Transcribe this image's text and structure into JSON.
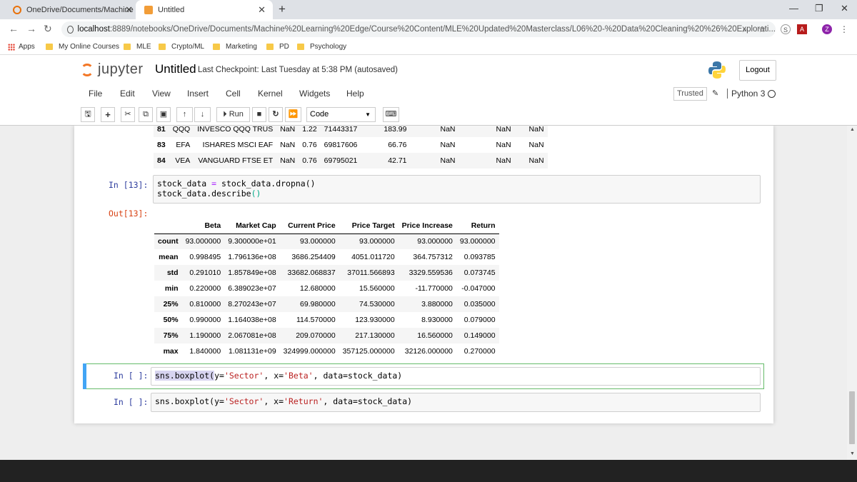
{
  "browser": {
    "tabs": [
      {
        "title": "OneDrive/Documents/Machine L"
      },
      {
        "title": "Untitled"
      }
    ],
    "new_tab": "+",
    "url_host": "localhost",
    "url_path": ":8889/notebooks/OneDrive/Documents/Machine%20Learning%20Edge/Course%20Content/MLE%20Updated%20Masterclass/L06%20-%20Data%20Cleaning%20%26%20Explorati...",
    "profile_letter": "Z",
    "bookmarks": [
      "Apps",
      "My Online Courses",
      "MLE",
      "Crypto/ML",
      "Marketing",
      "PD",
      "Psychology"
    ]
  },
  "jupyter": {
    "logo_text": "jupyter",
    "notebook_name": "Untitled",
    "checkpoint": "Last Checkpoint: Last Tuesday at 5:38 PM  (autosaved)",
    "logout": "Logout",
    "menu": [
      "File",
      "Edit",
      "View",
      "Insert",
      "Cell",
      "Kernel",
      "Widgets",
      "Help"
    ],
    "trusted": "Trusted",
    "kernel": "Python 3",
    "run_label": "Run",
    "cell_type": "Code"
  },
  "prev_output": {
    "rows": [
      {
        "idx": "81",
        "cells": [
          "QQQ",
          "INVESCO QQQ TRUS",
          "NaN",
          "1.22",
          "71443317",
          "183.99",
          "NaN",
          "NaN",
          "NaN"
        ]
      },
      {
        "idx": "83",
        "cells": [
          "EFA",
          "ISHARES MSCI EAF",
          "NaN",
          "0.76",
          "69817606",
          "66.76",
          "NaN",
          "NaN",
          "NaN"
        ]
      },
      {
        "idx": "84",
        "cells": [
          "VEA",
          "VANGUARD FTSE ET",
          "NaN",
          "0.76",
          "69795021",
          "42.71",
          "NaN",
          "NaN",
          "NaN"
        ]
      }
    ]
  },
  "cell13": {
    "prompt_in": "In [13]:",
    "line1_a": "stock_data ",
    "line1_op": "=",
    "line1_b": " stock_data.dropna()",
    "line2": "stock_data.describe",
    "line2_paren": "()",
    "prompt_out": "Out[13]:",
    "describe": {
      "columns": [
        "Beta",
        "Market Cap",
        "Current Price",
        "Price Target",
        "Price Increase",
        "Return"
      ],
      "rows": [
        {
          "stat": "count",
          "values": [
            "93.000000",
            "9.300000e+01",
            "93.000000",
            "93.000000",
            "93.000000",
            "93.000000"
          ]
        },
        {
          "stat": "mean",
          "values": [
            "0.998495",
            "1.796136e+08",
            "3686.254409",
            "4051.011720",
            "364.757312",
            "0.093785"
          ]
        },
        {
          "stat": "std",
          "values": [
            "0.291010",
            "1.857849e+08",
            "33682.068837",
            "37011.566893",
            "3329.559536",
            "0.073745"
          ]
        },
        {
          "stat": "min",
          "values": [
            "0.220000",
            "6.389023e+07",
            "12.680000",
            "15.560000",
            "-11.770000",
            "-0.047000"
          ]
        },
        {
          "stat": "25%",
          "values": [
            "0.810000",
            "8.270243e+07",
            "69.980000",
            "74.530000",
            "3.880000",
            "0.035000"
          ]
        },
        {
          "stat": "50%",
          "values": [
            "0.990000",
            "1.164038e+08",
            "114.570000",
            "123.930000",
            "8.930000",
            "0.079000"
          ]
        },
        {
          "stat": "75%",
          "values": [
            "1.190000",
            "2.067081e+08",
            "209.070000",
            "217.130000",
            "16.560000",
            "0.149000"
          ]
        },
        {
          "stat": "max",
          "values": [
            "1.840000",
            "1.081131e+09",
            "324999.000000",
            "357125.000000",
            "32126.000000",
            "0.270000"
          ]
        }
      ]
    }
  },
  "cell_a": {
    "prompt": "In [ ]:",
    "fn": "sns.boxplot(",
    "arg_y": "y=",
    "y_val": "'Sector'",
    "arg_x": ", x=",
    "x_val": "'Beta'",
    "rest": ", data=stock_data)"
  },
  "cell_b": {
    "prompt": "In [ ]:",
    "fn": "sns.boxplot(y=",
    "y_val": "'Sector'",
    "arg_x": ", x=",
    "x_val": "'Return'",
    "rest": ", data=stock_data)"
  }
}
